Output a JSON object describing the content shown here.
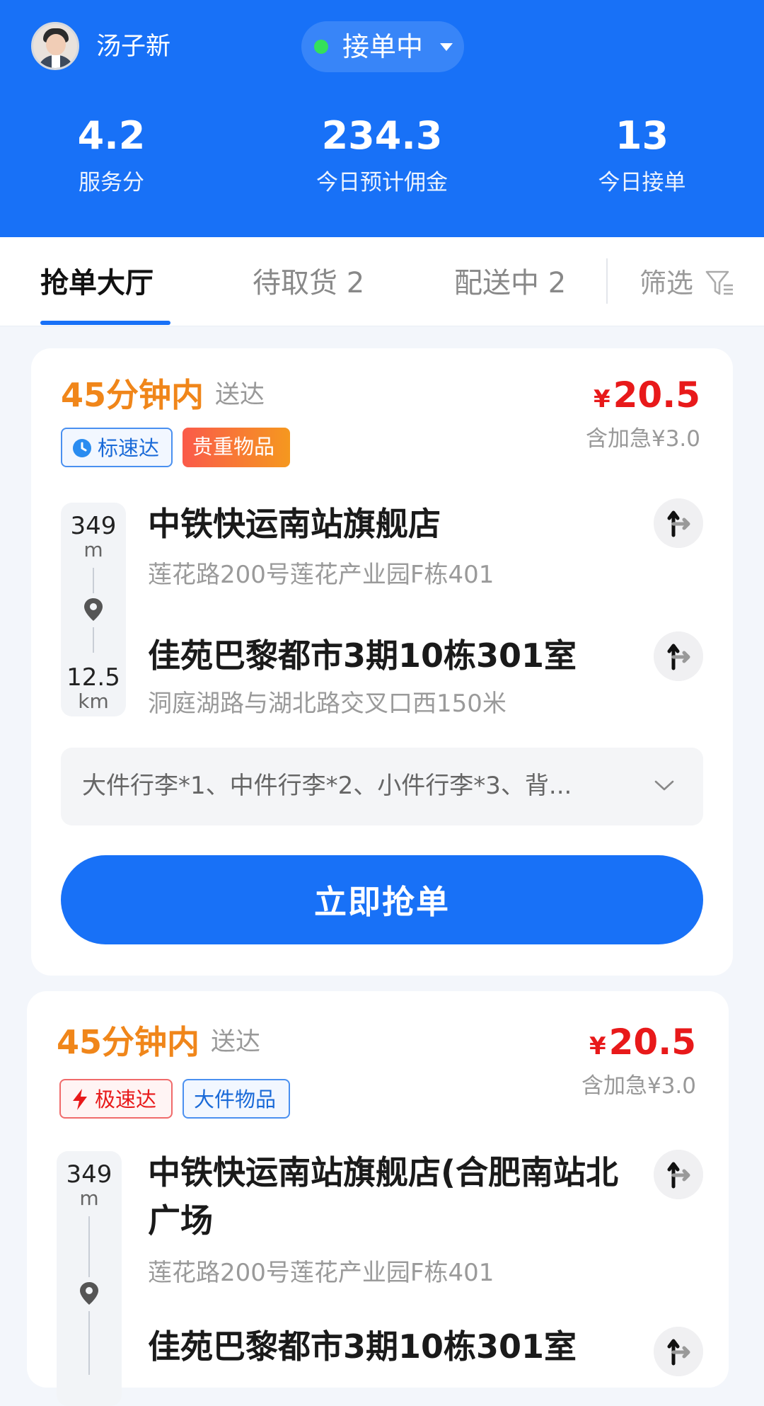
{
  "header": {
    "username": "汤子新",
    "status": "接单中",
    "stats": [
      {
        "value": "4.2",
        "label": "服务分"
      },
      {
        "value": "234.3",
        "label": "今日预计佣金"
      },
      {
        "value": "13",
        "label": "今日接单"
      }
    ]
  },
  "tabs": {
    "items": [
      {
        "label": "抢单大厅"
      },
      {
        "label": "待取货 2"
      },
      {
        "label": "配送中 2"
      }
    ],
    "filter_label": "筛选"
  },
  "orders": [
    {
      "eta": "45分钟内",
      "eta_suffix": "送达",
      "currency": "¥",
      "price": "20.5",
      "surcharge": "含加急¥3.0",
      "tags": [
        "标速达",
        "贵重物品"
      ],
      "pickup": {
        "distance": "349",
        "unit": "m",
        "name": "中铁快运南站旗舰店",
        "address": "莲花路200号莲花产业园F栋401"
      },
      "dropoff": {
        "distance": "12.5",
        "unit": "km",
        "name": "佳苑巴黎都市3期10栋301室",
        "address": "洞庭湖路与湖北路交叉口西150米"
      },
      "items": "大件行李*1、中件行李*2、小件行李*3、背...",
      "action": "立即抢单"
    },
    {
      "eta": "45分钟内",
      "eta_suffix": "送达",
      "currency": "¥",
      "price": "20.5",
      "surcharge": "含加急¥3.0",
      "tags": [
        "极速达",
        "大件物品"
      ],
      "pickup": {
        "distance": "349",
        "unit": "m",
        "name": "中铁快运南站旗舰店(合肥南站北广场",
        "address": "莲花路200号莲花产业园F栋401"
      },
      "dropoff": {
        "name": "佳苑巴黎都市3期10栋301室"
      }
    }
  ],
  "icons": {
    "clock": "clock-icon",
    "lightning": "lightning-icon",
    "pin": "location-pin-icon",
    "navigate": "turn-right-arrow-icon",
    "filter": "filter-icon",
    "chevron": "chevron-down-icon"
  },
  "colors": {
    "brand_blue": "#1871f7",
    "eta_orange": "#f0861a",
    "price_red": "#e8191a",
    "online_green": "#34e05a"
  }
}
